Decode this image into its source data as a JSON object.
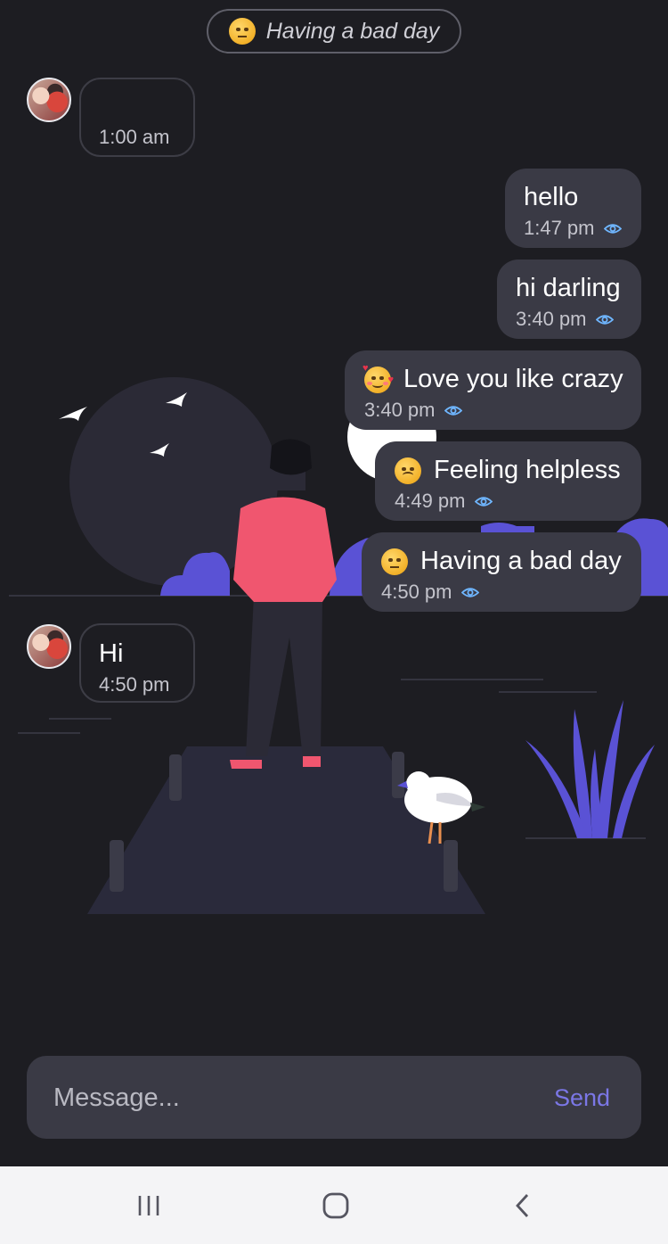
{
  "status": {
    "text": "Having a bad day",
    "emoji": "unamused-face-emoji"
  },
  "messages": [
    {
      "direction": "in",
      "text": "",
      "time": "1:00 am"
    },
    {
      "direction": "out",
      "text": "hello",
      "time": "1:47 pm",
      "seen_icon": "eye-icon"
    },
    {
      "direction": "out",
      "text": "hi darling",
      "time": "3:40 pm",
      "seen_icon": "eye-icon"
    },
    {
      "direction": "out",
      "text": "Love you like crazy",
      "emoji": "smiling-face-with-hearts-emoji",
      "time": "3:40 pm",
      "seen_icon": "eye-icon"
    },
    {
      "direction": "out",
      "text": "Feeling helpless",
      "emoji": "frowning-face-emoji",
      "time": "4:49 pm",
      "seen_icon": "eye-icon"
    },
    {
      "direction": "out",
      "text": "Having a bad day",
      "emoji": "unamused-face-emoji",
      "time": "4:50 pm",
      "seen_icon": "eye-icon"
    },
    {
      "direction": "in",
      "text": "Hi",
      "time": "4:50 pm"
    }
  ],
  "composer": {
    "placeholder": "Message...",
    "send_label": "Send"
  },
  "colors": {
    "background": "#1d1d22",
    "bubble": "#3a3a45",
    "accent": "#7b77e6",
    "illustration_purple": "#5a52d5",
    "figure_pink": "#f0566f"
  },
  "navbar": {
    "icons": [
      "recent-apps-icon",
      "home-icon",
      "back-icon"
    ]
  }
}
